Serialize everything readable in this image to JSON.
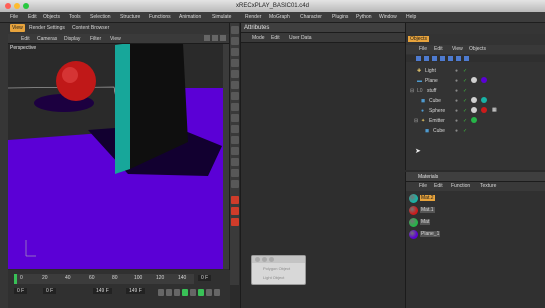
{
  "window": {
    "title": "xRECxPLAY_BASIC01.c4d"
  },
  "menu": [
    "File",
    "Edit",
    "Objects",
    "Tools",
    "Selection",
    "Structure",
    "Functions",
    "Animation",
    "Simulate",
    "Render",
    "MoGraph",
    "Character",
    "Plugins",
    "Python",
    "Window",
    "Help"
  ],
  "left_tabs": [
    "View",
    "Render Settings",
    "Content Browser"
  ],
  "viewport": {
    "menu": [
      "Edit",
      "Cameras",
      "Display",
      "Filter",
      "View"
    ],
    "label": "Perspective"
  },
  "attributes": {
    "title": "Attributes",
    "menu": [
      "Mode",
      "Edit",
      "User Data"
    ]
  },
  "objects": {
    "tab": "Objects",
    "menu": [
      "File",
      "Edit",
      "View",
      "Objects"
    ],
    "items": [
      {
        "name": "Light"
      },
      {
        "name": "Plane"
      },
      {
        "name": "stuff"
      },
      {
        "name": "Cube"
      },
      {
        "name": "Sphere"
      },
      {
        "name": "Emitter"
      },
      {
        "name": "Cube"
      }
    ]
  },
  "materials": {
    "title": "Materials",
    "menu": [
      "File",
      "Edit",
      "Function",
      "Texture"
    ],
    "items": [
      {
        "name": "Mat.2",
        "color": "#18b3a5",
        "selected": true
      },
      {
        "name": "Mat.1",
        "color": "#cc1b1b",
        "selected": false
      },
      {
        "name": "Mat",
        "color": "#26b548",
        "selected": false
      },
      {
        "name": "Plane_1",
        "color": "#5b00d6",
        "selected": false
      }
    ]
  },
  "timeline": {
    "ticks": [
      "0",
      "20",
      "40",
      "60",
      "80",
      "100",
      "120",
      "140"
    ],
    "frame_display": "0 F",
    "start": "0 F",
    "preview_start": "0 F",
    "preview_end": "149 F",
    "end": "149 F"
  },
  "floating": {
    "line1": "Polygon Object",
    "line2": "Light Object"
  }
}
